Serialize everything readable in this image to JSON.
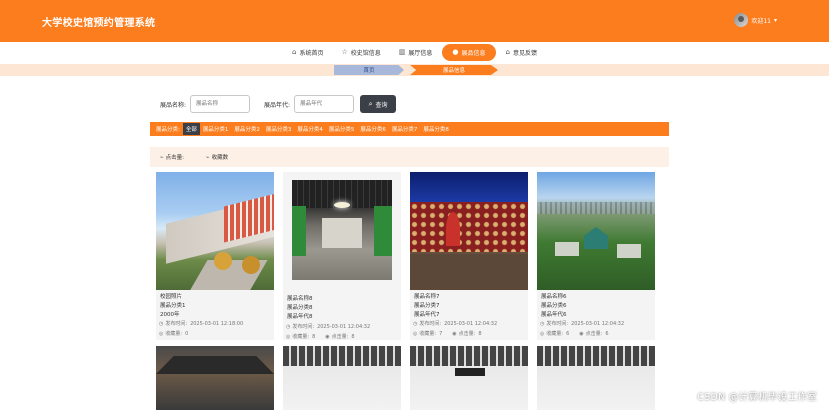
{
  "header": {
    "title": "大学校史馆预约管理系统",
    "user_label": "欢迎11",
    "caret": "▾"
  },
  "nav": {
    "items": [
      {
        "icon": "home-icon",
        "glyph": "⌂",
        "label": "系统首页"
      },
      {
        "icon": "star-icon",
        "glyph": "☆",
        "label": "校史馆信息"
      },
      {
        "icon": "building-icon",
        "glyph": "▥",
        "label": "展厅信息"
      },
      {
        "icon": "exhibit-icon",
        "glyph": "●",
        "label": "展品信息"
      },
      {
        "icon": "feedback-icon",
        "glyph": "⌂",
        "label": "意见反馈"
      }
    ],
    "active_index": 3
  },
  "breadcrumb": {
    "home": "首页",
    "current": "展品信息"
  },
  "search": {
    "name_label": "展品名称:",
    "name_placeholder": "展品名称",
    "era_label": "展品年代:",
    "era_placeholder": "展品年代",
    "button_label": "查询",
    "button_icon": "⌕"
  },
  "categories": {
    "label": "展品分类:",
    "items": [
      "全部",
      "展品分类1",
      "展品分类2",
      "展品分类3",
      "展品分类4",
      "展品分类5",
      "展品分类6",
      "展品分类7",
      "展品分类8"
    ],
    "selected_index": 0
  },
  "sort": {
    "clicks_label": "点击量:",
    "favorites_label": "收藏数",
    "icon_glyph": "⌁"
  },
  "cards": [
    {
      "line1": "校园照片",
      "line2": "展品分类1",
      "line3": "2000年",
      "published_label": "发布时间:",
      "published": "2025-03-01 12:18:00",
      "fav_label": "收藏量:",
      "fav": "0",
      "clicks_label": "点击量:",
      "clicks": ""
    },
    {
      "line1": "展品名称8",
      "line2": "展品分类8",
      "line3": "展品年代8",
      "published_label": "发布时间:",
      "published": "2025-03-01 12:04:32",
      "fav_label": "收藏量:",
      "fav": "8",
      "clicks_label": "点击量:",
      "clicks": "8"
    },
    {
      "line1": "展品名称7",
      "line2": "展品分类7",
      "line3": "展品年代7",
      "published_label": "发布时间:",
      "published": "2025-03-01 12:04:32",
      "fav_label": "收藏量:",
      "fav": "7",
      "clicks_label": "点击量:",
      "clicks": "8"
    },
    {
      "line1": "展品名称6",
      "line2": "展品分类6",
      "line3": "展品年代6",
      "published_label": "发布时间:",
      "published": "2025-03-01 12:04:32",
      "fav_label": "收藏量:",
      "fav": "6",
      "clicks_label": "点击量:",
      "clicks": "6"
    }
  ],
  "watermark": "CSDN @计算机毕设工作室"
}
